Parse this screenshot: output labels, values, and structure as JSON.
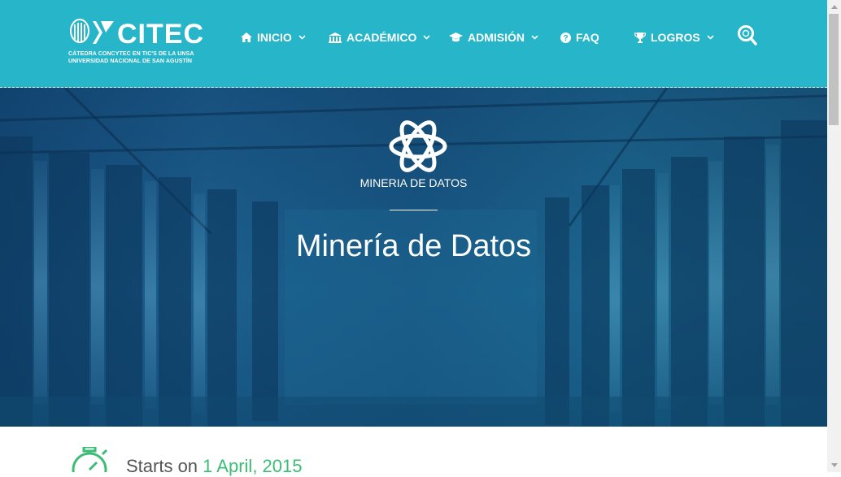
{
  "brand": {
    "name": "CITEC",
    "subtitle_line1": "CÁTEDRA CONCYTEC EN TIC'S DE LA UNSA",
    "subtitle_line2": "UNIVERSIDAD NACIONAL DE SAN AGUSTÍN"
  },
  "nav": {
    "items": [
      {
        "label": "INICIO",
        "icon": "home-icon",
        "has_dropdown": true
      },
      {
        "label": "ACADÉMICO",
        "icon": "institution-icon",
        "has_dropdown": true
      },
      {
        "label": "ADMISIÓN",
        "icon": "graduation-cap-icon",
        "has_dropdown": true
      },
      {
        "label": "FAQ",
        "icon": "question-circle-icon",
        "has_dropdown": false
      },
      {
        "label": "LOGROS",
        "icon": "trophy-icon",
        "has_dropdown": true
      }
    ],
    "search_icon": "search-icon"
  },
  "hero": {
    "icon": "atom-icon",
    "kicker": "MINERIA DE DATOS",
    "title": "Minería de Datos"
  },
  "course": {
    "starts_prefix": "Starts on",
    "starts_date": "1 April, 2015",
    "icon": "stopwatch-icon"
  },
  "colors": {
    "header_bg": "#26b5c9",
    "accent_green": "#3bbd76",
    "text_white": "#ffffff"
  }
}
